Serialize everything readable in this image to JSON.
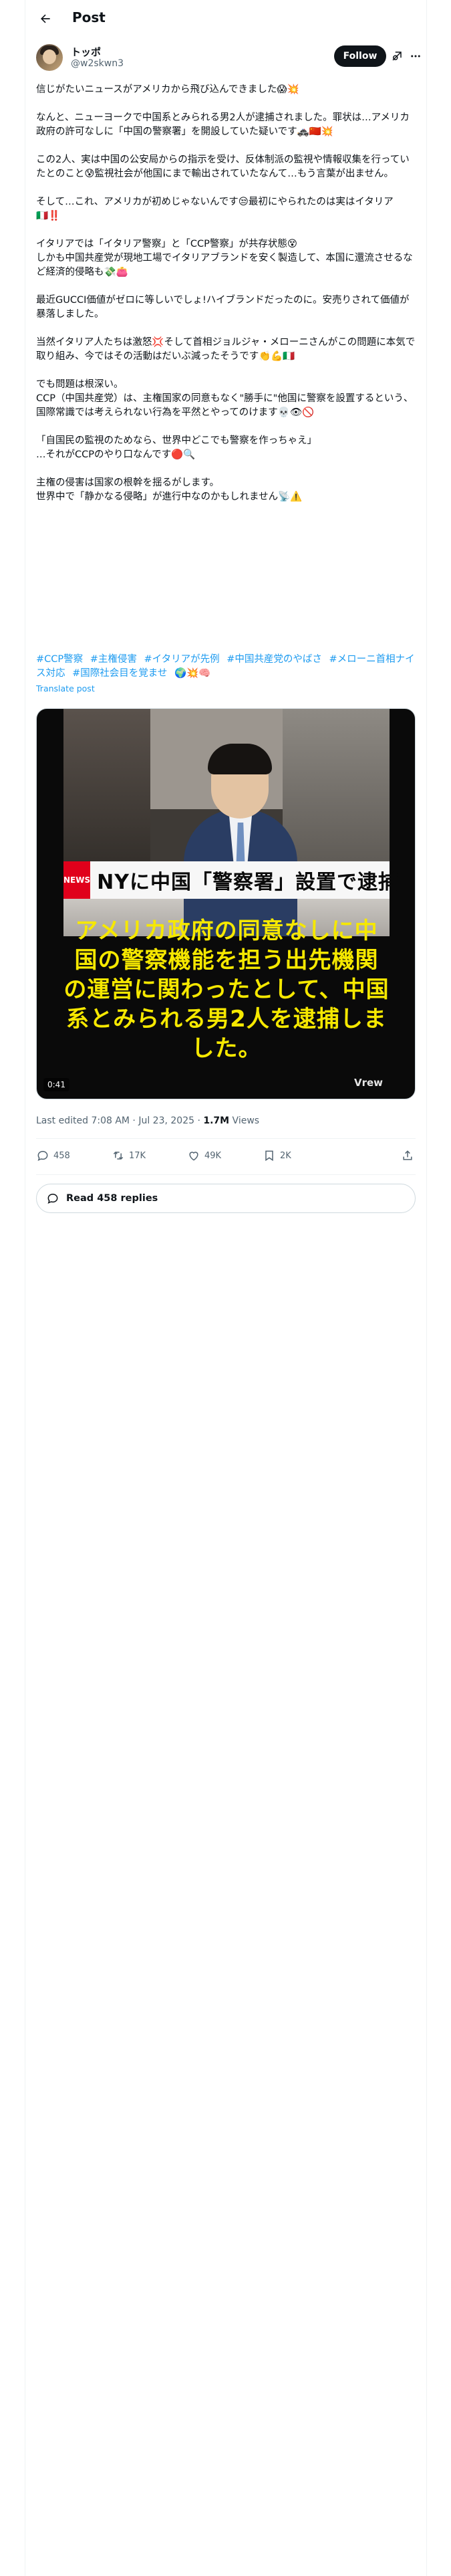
{
  "header": {
    "title": "Post"
  },
  "author": {
    "display_name": "トッポ",
    "handle": "@w2skwn3",
    "follow_label": "Follow"
  },
  "tweet": {
    "paragraphs": [
      "信じがたいニュースがアメリカから飛び込んできました😱💥",
      "なんと、ニューヨークで中国系とみられる男2人が逮捕されました。罪状は…アメリカ政府の許可なしに「中国の警察署」を開設していた疑いです🚓🇨🇳💥",
      "この2人、実は中国の公安局からの指示を受け、反体制派の監視や情報収集を行っていたとのこと😰監視社会が他国にまで輸出されていたなんて…もう言葉が出ません。",
      "そして…これ、アメリカが初めじゃないんです😒最初にやられたのは実はイタリア🇮🇹‼️",
      "イタリアでは「イタリア警察」と「CCP警察」が共存状態😵\nしかも中国共産党が現地工場でイタリアブランドを安く製造して、本国に還流させるなど経済的侵略も💸👛",
      "最近GUCCI価値がゼロに等しいでしょ!ハイブランドだったのに。安売りされて価値が暴落しました。",
      "当然イタリア人たちは激怒💢そして首相ジョルジャ・メローニさんがこの問題に本気で取り組み、今ではその活動はだいぶ減ったそうです👏💪🇮🇹",
      "でも問題は根深い。\nCCP（中国共産党）は、主権国家の同意もなく\"勝手に\"他国に警察を設置するという、国際常識では考えられない行為を平然とやってのけます💀👁🚫",
      "「自国民の監視のためなら、世界中どこでも警察を作っちゃえ」\n…それがCCPのやり口なんです🔴🔍",
      "主権の侵害は国家の根幹を揺るがします。\n世界中で「静かなる侵略」が進行中なのかもしれません📡⚠️"
    ],
    "hashtags": [
      "#CCP警察",
      "#主権侵害",
      "#イタリアが先例",
      "#中国共産党のやばさ",
      "#メローニ首相ナイス対応",
      "#国際社会目を覚ませ",
      "🌍💥🧠"
    ],
    "translate_label": "Translate post"
  },
  "video": {
    "news_tag": "NEWS",
    "lower_third": "NYに中国「警察署」設置で逮捕",
    "caption": "アメリカ政府の同意なしに中国の警察機能を担う出先機関の運営に関わったとして、中国系とみられる男2人を逮捕しました。",
    "watermark": "Vrew",
    "duration": "0:41"
  },
  "meta": {
    "edited": "Last edited 7:08 AM · Jul 23, 2025 · ",
    "views_count": "1.7M",
    "views_label": " Views"
  },
  "actions": {
    "replies": "458",
    "reposts": "17K",
    "likes": "49K",
    "bookmarks": "2K"
  },
  "read_replies_label": "Read 458 replies"
}
